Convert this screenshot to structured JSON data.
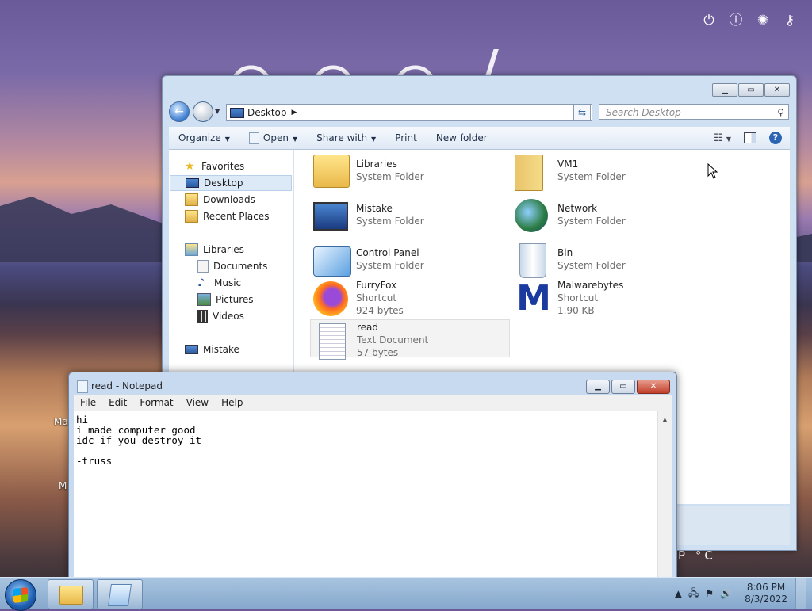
{
  "desktop": {
    "clock_glyphs": "ooo/",
    "temp_text": "P °C",
    "hidden_icon_labels": [
      "Ma",
      "M"
    ],
    "top_icons": [
      "power-icon",
      "info-icon",
      "loading-icon",
      "key-icon"
    ]
  },
  "explorer": {
    "address": "Desktop",
    "search_placeholder": "Search Desktop",
    "toolbar": {
      "organize": "Organize",
      "open": "Open",
      "share_with": "Share with",
      "print": "Print",
      "new_folder": "New folder"
    },
    "nav": {
      "favorites": "Favorites",
      "desktop": "Desktop",
      "downloads": "Downloads",
      "recent_places": "Recent Places",
      "libraries": "Libraries",
      "documents": "Documents",
      "music": "Music",
      "pictures": "Pictures",
      "videos": "Videos",
      "mistake": "Mistake"
    },
    "items": [
      {
        "name": "Libraries",
        "type": "System Folder",
        "size": ""
      },
      {
        "name": "VM1",
        "type": "System Folder",
        "size": ""
      },
      {
        "name": "Mistake",
        "type": "System Folder",
        "size": ""
      },
      {
        "name": "Network",
        "type": "System Folder",
        "size": ""
      },
      {
        "name": "Control Panel",
        "type": "System Folder",
        "size": ""
      },
      {
        "name": "Bin",
        "type": "System Folder",
        "size": ""
      },
      {
        "name": "FurryFox",
        "type": "Shortcut",
        "size": "924 bytes"
      },
      {
        "name": "Malwarebytes",
        "type": "Shortcut",
        "size": "1.90 KB"
      },
      {
        "name": "read",
        "type": "Text Document",
        "size": "57 bytes"
      }
    ]
  },
  "notepad": {
    "title": "read - Notepad",
    "menu": [
      "File",
      "Edit",
      "Format",
      "View",
      "Help"
    ],
    "content": "hi\ni made computer good\nidc if you destroy it\n\n-truss"
  },
  "taskbar": {
    "time": "8:06 PM",
    "date": "8/3/2022"
  }
}
